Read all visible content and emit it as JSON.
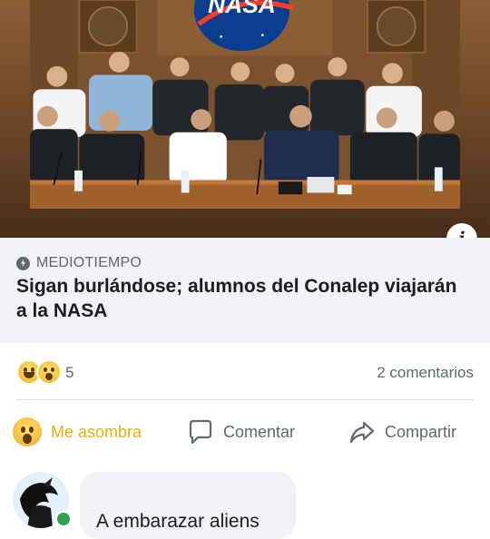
{
  "photo": {
    "sign_text": "NASA",
    "colors": {
      "wood": "#7a5230",
      "nasa_blue": "#0b3d91",
      "nasa_red": "#fc3d21"
    }
  },
  "post": {
    "source": "MEDIOTIEMPO",
    "source_icon": "bolt-icon",
    "headline": "Sigan burlándose; alumnos del Conalep viajarán a la NASA"
  },
  "reactions": {
    "icons": [
      "laugh-icon",
      "wow-icon"
    ],
    "count": "5",
    "comments_label": "2 comentarios"
  },
  "actions": {
    "react_label": "Me asombra",
    "comment_label": "Comentar",
    "share_label": "Compartir",
    "react_color": "#e8b006"
  },
  "comment": {
    "text": "A embarazar aliens",
    "online_color": "#31a24c"
  }
}
